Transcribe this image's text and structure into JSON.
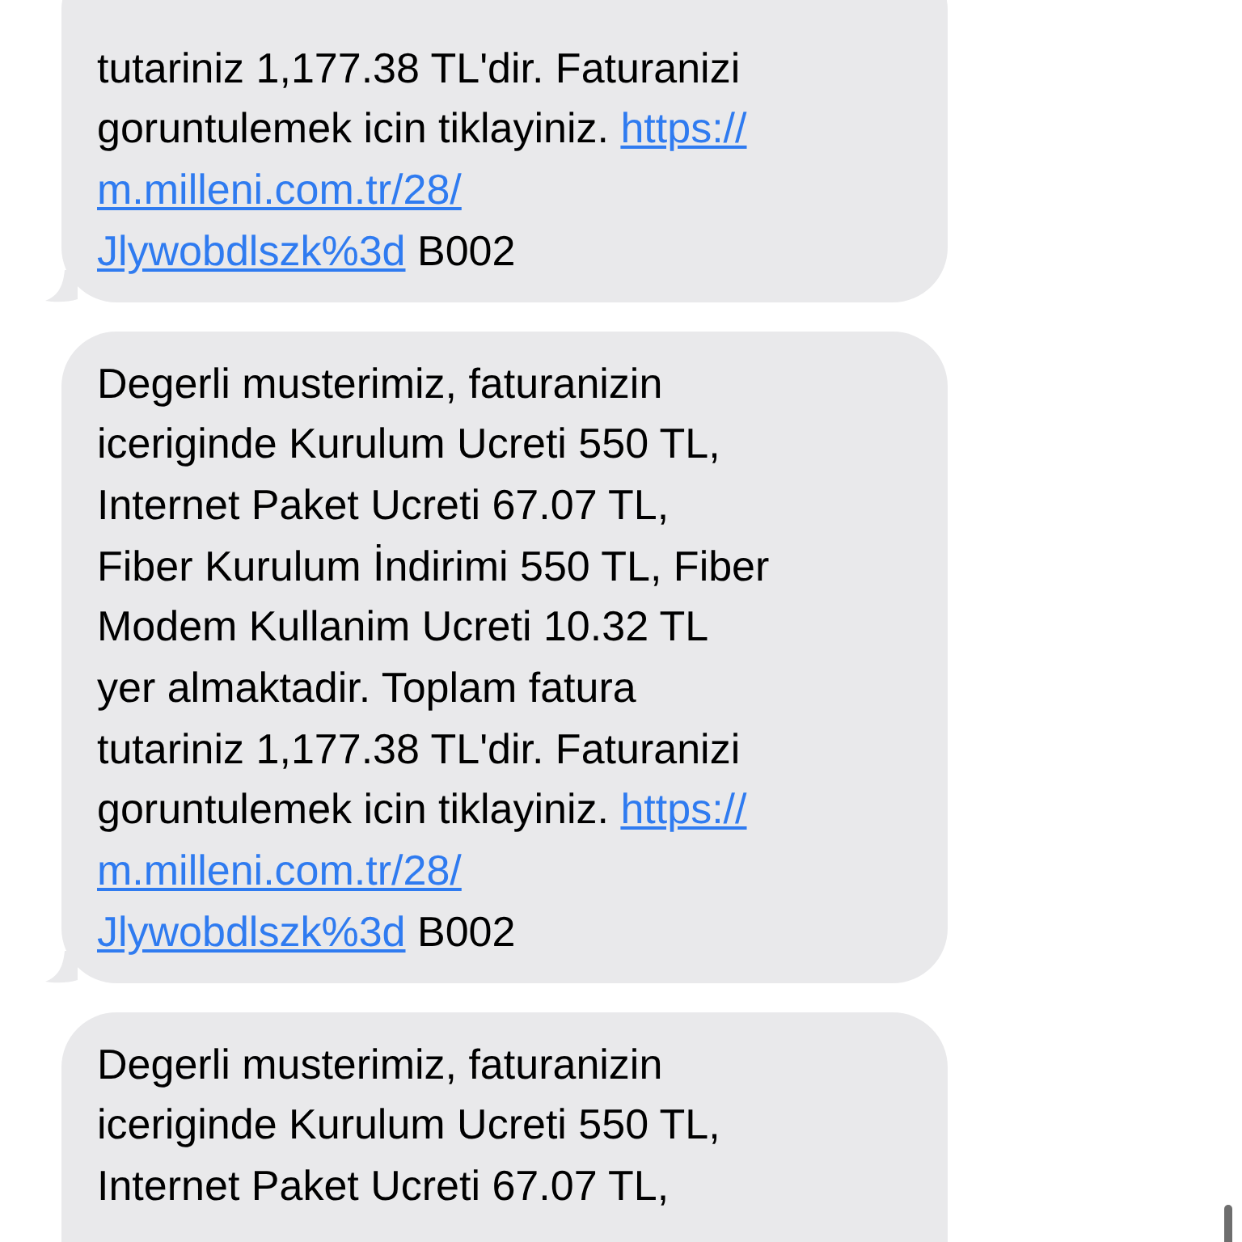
{
  "messages": [
    {
      "lines": [
        [
          {
            "kind": "text",
            "text": "tutariniz 1,177.38 TL'dir. Faturanizi"
          }
        ],
        [
          {
            "kind": "text",
            "text": "goruntulemek icin tiklayiniz. "
          },
          {
            "kind": "link",
            "text": "https://"
          }
        ],
        [
          {
            "kind": "link",
            "text": "m.milleni.com.tr/28/"
          }
        ],
        [
          {
            "kind": "link",
            "text": "Jlywobdlszk%3d"
          },
          {
            "kind": "text",
            "text": " B002"
          }
        ]
      ]
    },
    {
      "lines": [
        [
          {
            "kind": "text",
            "text": "Degerli musterimiz, faturanizin"
          }
        ],
        [
          {
            "kind": "text",
            "text": "iceriginde Kurulum Ucreti 550 TL,"
          }
        ],
        [
          {
            "kind": "text",
            "text": "Internet Paket Ucreti 67.07 TL,"
          }
        ],
        [
          {
            "kind": "text",
            "text": "Fiber Kurulum İndirimi 550 TL, Fiber"
          }
        ],
        [
          {
            "kind": "text",
            "text": "Modem Kullanim Ucreti 10.32 TL"
          }
        ],
        [
          {
            "kind": "text",
            "text": "yer almaktadir. Toplam fatura"
          }
        ],
        [
          {
            "kind": "text",
            "text": "tutariniz 1,177.38 TL'dir. Faturanizi"
          }
        ],
        [
          {
            "kind": "text",
            "text": "goruntulemek icin tiklayiniz. "
          },
          {
            "kind": "link",
            "text": "https://"
          }
        ],
        [
          {
            "kind": "link",
            "text": "m.milleni.com.tr/28/"
          }
        ],
        [
          {
            "kind": "link",
            "text": "Jlywobdlszk%3d"
          },
          {
            "kind": "text",
            "text": " B002"
          }
        ]
      ]
    },
    {
      "lines": [
        [
          {
            "kind": "text",
            "text": "Degerli musterimiz, faturanizin"
          }
        ],
        [
          {
            "kind": "text",
            "text": "iceriginde Kurulum Ucreti 550 TL,"
          }
        ],
        [
          {
            "kind": "text",
            "text": "Internet Paket Ucreti 67.07 TL,"
          }
        ]
      ]
    }
  ]
}
